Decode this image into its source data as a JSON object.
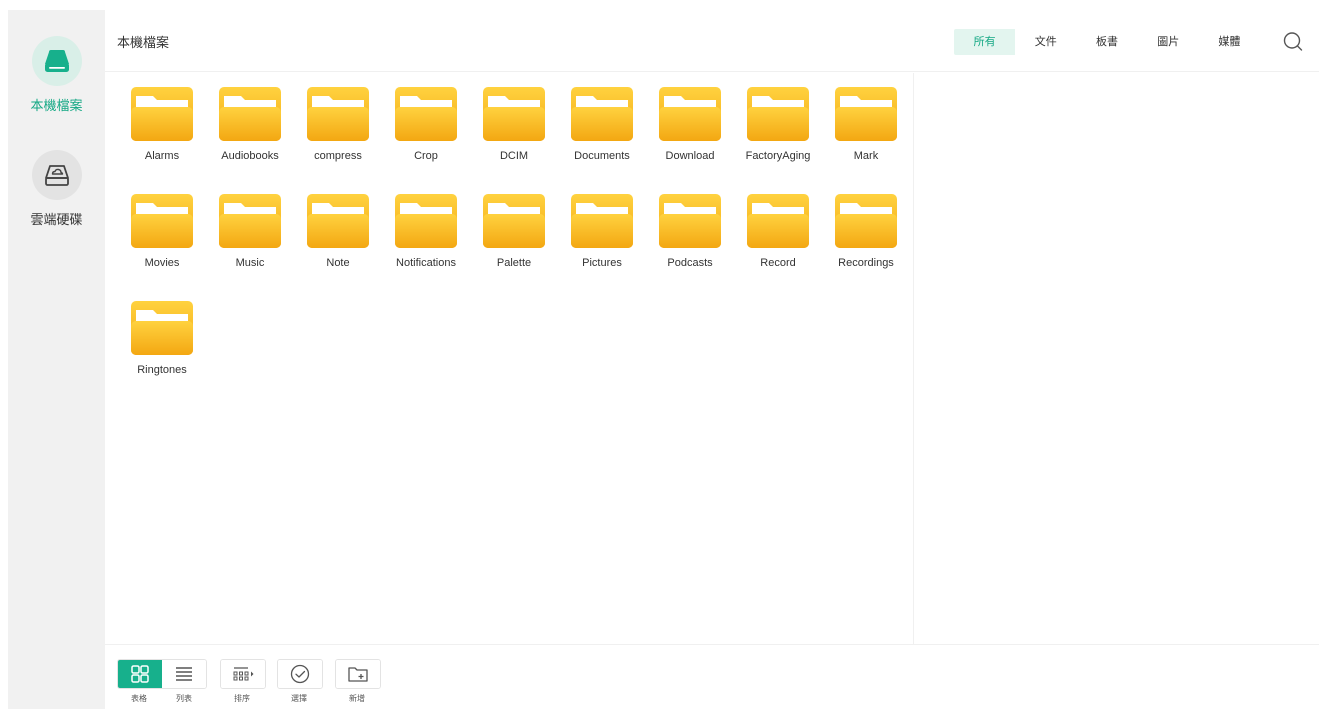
{
  "sidebar": {
    "items": [
      {
        "label": "本機檔案",
        "icon": "hard-drive-icon",
        "active": true
      },
      {
        "label": "雲端硬碟",
        "icon": "cloud-drive-icon",
        "active": false
      }
    ]
  },
  "header": {
    "title": "本機檔案",
    "filters": [
      {
        "label": "所有",
        "active": true
      },
      {
        "label": "文件",
        "active": false
      },
      {
        "label": "板書",
        "active": false
      },
      {
        "label": "圖片",
        "active": false
      },
      {
        "label": "媒體",
        "active": false
      }
    ],
    "search_icon": "search-icon"
  },
  "folders": [
    "Alarms",
    "Audiobooks",
    "compress",
    "Crop",
    "DCIM",
    "Documents",
    "Download",
    "FactoryAging",
    "Mark",
    "Movies",
    "Music",
    "Note",
    "Notifications",
    "Palette",
    "Pictures",
    "Podcasts",
    "Record",
    "Recordings",
    "Ringtones"
  ],
  "toolbar": {
    "grid_label": "表格",
    "list_label": "列表",
    "sort_label": "排序",
    "select_label": "選擇",
    "new_label": "新增"
  },
  "colors": {
    "accent": "#17b08c",
    "accent_light": "#e3f5ef",
    "folder_top": "#ffd23f",
    "folder_bottom": "#f3a712",
    "sidebar_bg": "#f1f1f1"
  }
}
